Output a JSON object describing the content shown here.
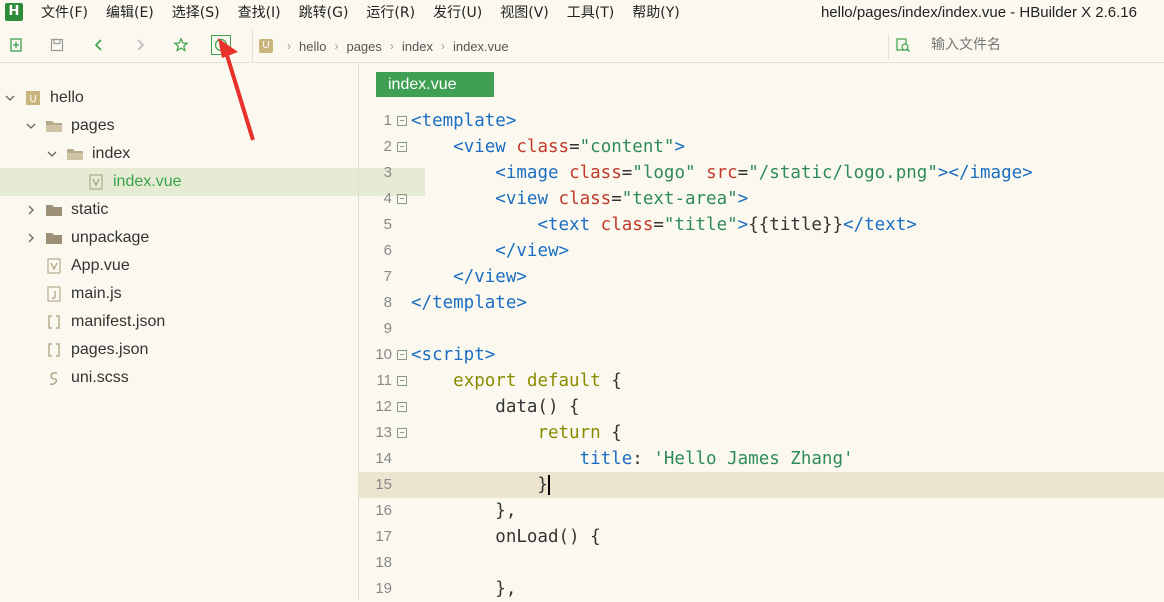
{
  "app": {
    "logo_letter": "H",
    "window_title": "hello/pages/index/index.vue - HBuilder X 2.6.16"
  },
  "menu": [
    "文件(F)",
    "编辑(E)",
    "选择(S)",
    "查找(I)",
    "跳转(G)",
    "运行(R)",
    "发行(U)",
    "视图(V)",
    "工具(T)",
    "帮助(Y)"
  ],
  "toolbar": {
    "breadcrumb": [
      "hello",
      "pages",
      "index",
      "index.vue"
    ],
    "search_placeholder": "输入文件名"
  },
  "tree": [
    {
      "label": "hello",
      "depth": 0,
      "chevron": "down",
      "icon": "project-icon"
    },
    {
      "label": "pages",
      "depth": 1,
      "chevron": "down",
      "icon": "folder-open-icon"
    },
    {
      "label": "index",
      "depth": 2,
      "chevron": "down",
      "icon": "folder-open-icon"
    },
    {
      "label": "index.vue",
      "depth": 3,
      "chevron": "none",
      "icon": "vue-file-icon",
      "selected": true
    },
    {
      "label": "static",
      "depth": 1,
      "chevron": "right",
      "icon": "folder-icon"
    },
    {
      "label": "unpackage",
      "depth": 1,
      "chevron": "right",
      "icon": "folder-icon"
    },
    {
      "label": "App.vue",
      "depth": 1,
      "chevron": "none",
      "icon": "vue-file-icon"
    },
    {
      "label": "main.js",
      "depth": 1,
      "chevron": "none",
      "icon": "js-file-icon"
    },
    {
      "label": "manifest.json",
      "depth": 1,
      "chevron": "none",
      "icon": "json-file-icon"
    },
    {
      "label": "pages.json",
      "depth": 1,
      "chevron": "none",
      "icon": "json-file-icon"
    },
    {
      "label": "uni.scss",
      "depth": 1,
      "chevron": "none",
      "icon": "scss-file-icon"
    }
  ],
  "editor": {
    "tab": "index.vue",
    "lines": [
      {
        "n": "1",
        "fold": "⊟",
        "html": "<span class='tag'>&lt;template&gt;</span>"
      },
      {
        "n": "2",
        "fold": "⊟",
        "html": "    <span class='tag'>&lt;view</span> <span class='attr'>class</span>=<span class='str'>\"content\"</span><span class='tag'>&gt;</span>"
      },
      {
        "n": "3",
        "fold": "",
        "html": "        <span class='tag'>&lt;image</span> <span class='attr'>class</span>=<span class='str'>\"logo\"</span> <span class='attr'>src</span>=<span class='str'>\"/static/logo.png\"</span><span class='tag'>&gt;&lt;/image&gt;</span>"
      },
      {
        "n": "4",
        "fold": "⊟",
        "html": "        <span class='tag'>&lt;view</span> <span class='attr'>class</span>=<span class='str'>\"text-area\"</span><span class='tag'>&gt;</span>"
      },
      {
        "n": "5",
        "fold": "",
        "html": "            <span class='tag'>&lt;text</span> <span class='attr'>class</span>=<span class='str'>\"title\"</span><span class='tag'>&gt;</span>{{title}}<span class='tag'>&lt;/text&gt;</span>"
      },
      {
        "n": "6",
        "fold": "",
        "html": "        <span class='tag'>&lt;/view&gt;</span>"
      },
      {
        "n": "7",
        "fold": "",
        "html": "    <span class='tag'>&lt;/view&gt;</span>"
      },
      {
        "n": "8",
        "fold": "",
        "html": "<span class='tag'>&lt;/template&gt;</span>"
      },
      {
        "n": "9",
        "fold": "",
        "html": ""
      },
      {
        "n": "10",
        "fold": "⊟",
        "html": "<span class='tag'>&lt;script&gt;</span>"
      },
      {
        "n": "11",
        "fold": "⊟",
        "html": "    <span class='kw'>export default</span> {"
      },
      {
        "n": "12",
        "fold": "⊟",
        "html": "        data() {"
      },
      {
        "n": "13",
        "fold": "⊟",
        "html": "            <span class='kw'>return</span> {"
      },
      {
        "n": "14",
        "fold": "",
        "html": "                <span class='prop'>title</span>: <span class='str'>'Hello James Zhang'</span>"
      },
      {
        "n": "15",
        "fold": "",
        "html": "            }<span id='cursor'></span>",
        "current": true
      },
      {
        "n": "16",
        "fold": "",
        "html": "        },"
      },
      {
        "n": "17",
        "fold": "",
        "html": "        onLoad() {"
      },
      {
        "n": "18",
        "fold": "",
        "html": ""
      },
      {
        "n": "19",
        "fold": "",
        "html": "        },"
      }
    ]
  }
}
